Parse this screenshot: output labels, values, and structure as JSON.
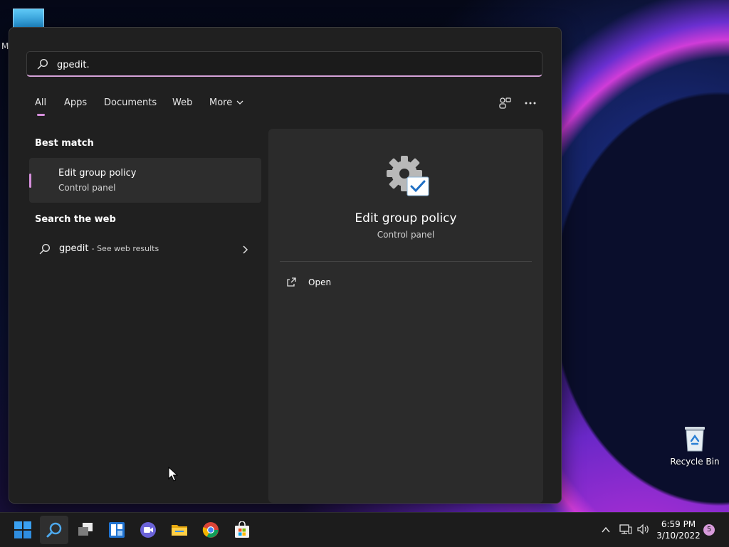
{
  "desktop": {
    "top_icon_letter": "M",
    "recycle_bin_label": "Recycle Bin"
  },
  "search": {
    "query": "gpedit.",
    "tabs": [
      "All",
      "Apps",
      "Documents",
      "Web",
      "More"
    ],
    "active_tab": "All"
  },
  "results": {
    "best_match_heading": "Best match",
    "best_match": {
      "title": "Edit group policy",
      "subtitle": "Control panel"
    },
    "web_heading": "Search the web",
    "web_result": {
      "query": "gpedit",
      "suffix": "- See web results"
    }
  },
  "preview": {
    "title": "Edit group policy",
    "subtitle": "Control panel",
    "actions": [
      {
        "label": "Open",
        "icon": "open-external-icon"
      }
    ]
  },
  "taskbar": {
    "apps": [
      "start-icon",
      "search-icon",
      "task-view-icon",
      "widgets-icon",
      "teams-chat-icon",
      "file-explorer-icon",
      "chrome-icon",
      "store-icon"
    ],
    "time": "6:59 PM",
    "date": "3/10/2022",
    "notification_count": "5"
  },
  "colors": {
    "accent": "#d68fdc",
    "panel_bg": "#202020",
    "pane_bg": "#2b2b2b"
  }
}
